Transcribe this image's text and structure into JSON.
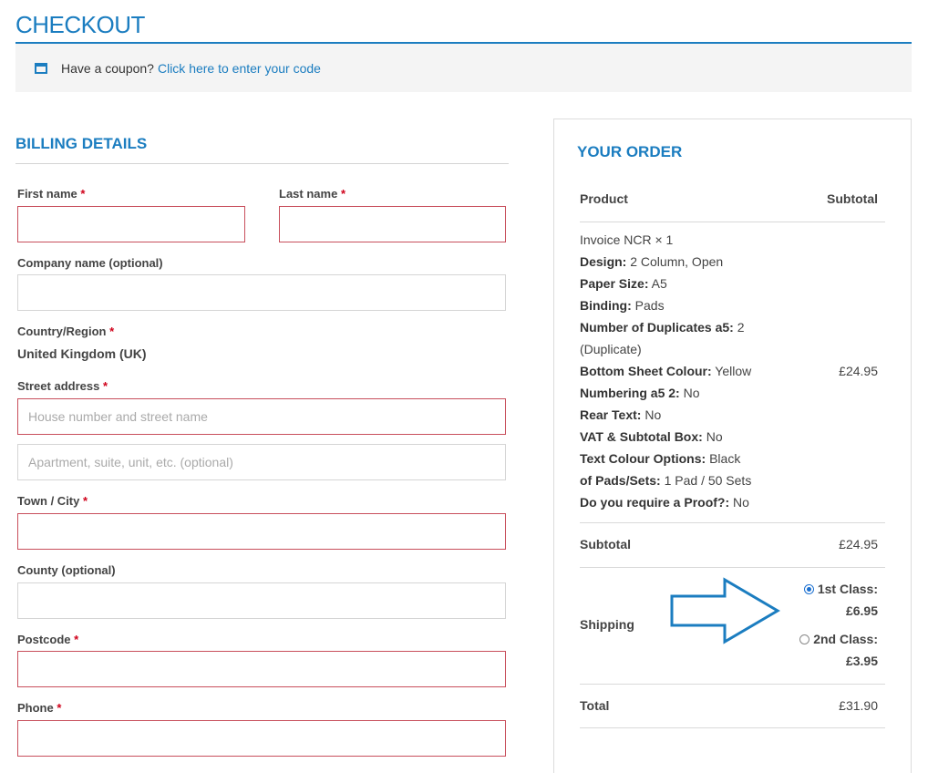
{
  "page": {
    "title": "CHECKOUT"
  },
  "coupon": {
    "prompt": "Have a coupon?",
    "link": "Click here to enter your code"
  },
  "billing": {
    "title": "BILLING DETAILS",
    "first_name": {
      "label": "First name",
      "value": ""
    },
    "last_name": {
      "label": "Last name",
      "value": ""
    },
    "company": {
      "label": "Company name (optional)",
      "value": ""
    },
    "country": {
      "label": "Country/Region",
      "value": "United Kingdom (UK)"
    },
    "street": {
      "label": "Street address",
      "placeholder1": "House number and street name",
      "placeholder2": "Apartment, suite, unit, etc. (optional)"
    },
    "city": {
      "label": "Town / City",
      "value": ""
    },
    "county": {
      "label": "County (optional)",
      "value": ""
    },
    "postcode": {
      "label": "Postcode",
      "value": ""
    },
    "phone": {
      "label": "Phone",
      "value": ""
    },
    "required_mark": "*"
  },
  "order": {
    "title": "YOUR ORDER",
    "col_product": "Product",
    "col_subtotal": "Subtotal",
    "item": {
      "name": "Invoice NCR",
      "qty": "× 1",
      "price": "£24.95",
      "meta": [
        {
          "key": "Design:",
          "value": "2 Column, Open"
        },
        {
          "key": "Paper Size:",
          "value": "A5"
        },
        {
          "key": "Binding:",
          "value": "Pads"
        },
        {
          "key": "Number of Duplicates a5:",
          "value": "2"
        },
        {
          "key": "",
          "value": "(Duplicate)"
        },
        {
          "key": "Bottom Sheet Colour:",
          "value": "Yellow"
        },
        {
          "key": "Numbering a5 2:",
          "value": "No"
        },
        {
          "key": "Rear Text:",
          "value": "No"
        },
        {
          "key": "VAT & Subtotal Box:",
          "value": "No"
        },
        {
          "key": "Text Colour Options:",
          "value": "Black"
        },
        {
          "key": "of Pads/Sets:",
          "value": "1 Pad / 50 Sets"
        },
        {
          "key": "Do you require a Proof?:",
          "value": "No"
        }
      ]
    },
    "subtotal_label": "Subtotal",
    "subtotal_value": "£24.95",
    "shipping_label": "Shipping",
    "shipping_options": [
      {
        "label": "1st Class:",
        "price": "£6.95",
        "selected": true
      },
      {
        "label": "2nd Class:",
        "price": "£3.95",
        "selected": false
      }
    ],
    "total_label": "Total",
    "total_value": "£31.90"
  },
  "colors": {
    "accent": "#1b7dc0",
    "invalid_border": "#c84f5c",
    "required": "#d0021b",
    "arrow": "#1b7dc0"
  },
  "icons": {
    "coupon": "window-icon",
    "arrow": "right-arrow-annotation"
  }
}
